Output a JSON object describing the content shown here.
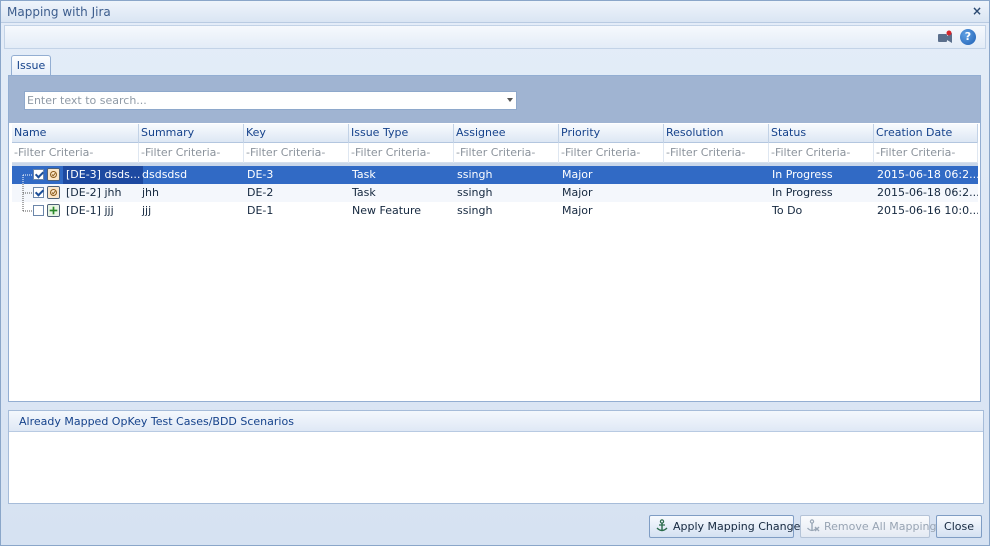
{
  "window": {
    "title": "Mapping with Jira",
    "close_glyph": "×"
  },
  "toolbar": {
    "video_icon": "video-camera-icon",
    "help_label": "?"
  },
  "tabs": [
    {
      "label": "Issue",
      "active": true
    }
  ],
  "search": {
    "placeholder": "Enter text to search...",
    "value": ""
  },
  "grid": {
    "columns": [
      {
        "key": "name",
        "label": "Name"
      },
      {
        "key": "summary",
        "label": "Summary"
      },
      {
        "key": "key",
        "label": "Key"
      },
      {
        "key": "issue_type",
        "label": "Issue Type"
      },
      {
        "key": "assignee",
        "label": "Assignee"
      },
      {
        "key": "priority",
        "label": "Priority"
      },
      {
        "key": "resolution",
        "label": "Resolution"
      },
      {
        "key": "status",
        "label": "Status"
      },
      {
        "key": "creation_date",
        "label": "Creation Date"
      }
    ],
    "filter_placeholder": "-Filter Criteria-",
    "rows": [
      {
        "checked": true,
        "type_icon": "task-icon",
        "name": "[DE-3] dsds...",
        "summary": "dsdsdsd",
        "key": "DE-3",
        "issue_type": "Task",
        "assignee": "ssingh",
        "priority": "Major",
        "resolution": "",
        "status": "In Progress",
        "creation_date": "2015-06-18 06:2...",
        "selected": true
      },
      {
        "checked": true,
        "type_icon": "task-icon",
        "name": "[DE-2] jhh",
        "summary": "jhh",
        "key": "DE-2",
        "issue_type": "Task",
        "assignee": "ssingh",
        "priority": "Major",
        "resolution": "",
        "status": "In Progress",
        "creation_date": "2015-06-18 06:2...",
        "selected": false
      },
      {
        "checked": false,
        "type_icon": "new-feature-icon",
        "name": "[DE-1] jjj",
        "summary": "jjj",
        "key": "DE-1",
        "issue_type": "New Feature",
        "assignee": "ssingh",
        "priority": "Major",
        "resolution": "",
        "status": "To Do",
        "creation_date": "2015-06-16 10:0...",
        "selected": false
      }
    ]
  },
  "mapped": {
    "header": "Already Mapped OpKey Test Cases/BDD Scenarios"
  },
  "buttons": {
    "apply": "Apply Mapping Changes",
    "remove_all": "Remove All Mappings",
    "close": "Close"
  }
}
